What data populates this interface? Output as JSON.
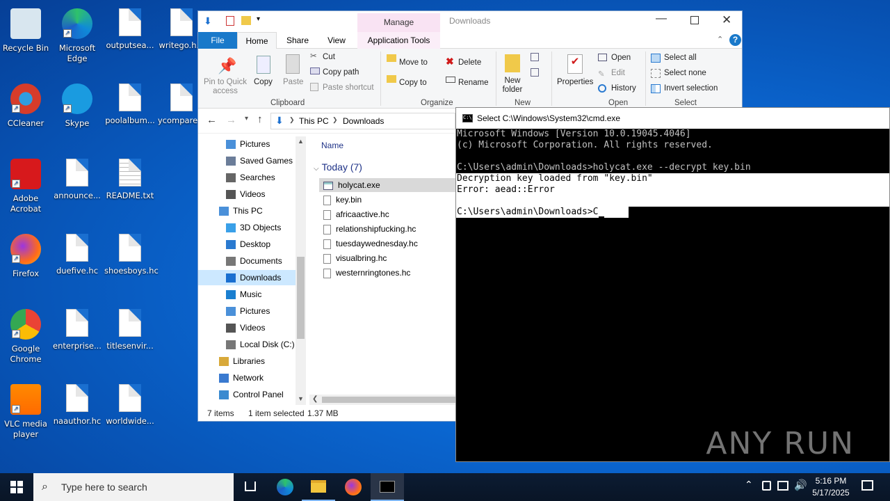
{
  "desktop": {
    "icons": [
      {
        "label": "Recycle Bin"
      },
      {
        "label": "Microsoft Edge"
      },
      {
        "label": "outputsea..."
      },
      {
        "label": "writego.h..."
      },
      {
        "label": "CCleaner"
      },
      {
        "label": "Skype"
      },
      {
        "label": "poolalbum..."
      },
      {
        "label": "ycompare..."
      },
      {
        "label": "Adobe Acrobat"
      },
      {
        "label": "announce..."
      },
      {
        "label": "README.txt"
      },
      {
        "label": "Firefox"
      },
      {
        "label": "duefive.hc"
      },
      {
        "label": "shoesboys.hc"
      },
      {
        "label": "Google Chrome"
      },
      {
        "label": "enterprise..."
      },
      {
        "label": "titlesenvir..."
      },
      {
        "label": "VLC media player"
      },
      {
        "label": "naauthor.hc"
      },
      {
        "label": "worldwide..."
      }
    ]
  },
  "explorer": {
    "title": "Downloads",
    "tabs": {
      "file": "File",
      "home": "Home",
      "share": "Share",
      "view": "View",
      "manage": "Manage",
      "app_tools": "Application Tools"
    },
    "ribbon": {
      "pin": "Pin to Quick access",
      "copy": "Copy",
      "paste": "Paste",
      "cut": "Cut",
      "copy_path": "Copy path",
      "paste_shortcut": "Paste shortcut",
      "clipboard": "Clipboard",
      "move_to": "Move to",
      "copy_to": "Copy to",
      "delete": "Delete",
      "rename": "Rename",
      "organize": "Organize",
      "new_folder": "New folder",
      "new": "New",
      "properties": "Properties",
      "open": "Open",
      "edit": "Edit",
      "history": "History",
      "open_group": "Open",
      "select_all": "Select all",
      "select_none": "Select none",
      "invert": "Invert selection",
      "select_group": "Select"
    },
    "address": {
      "this_pc": "This PC",
      "downloads": "Downloads"
    },
    "nav": [
      "Pictures",
      "Saved Games",
      "Searches",
      "Videos",
      "This PC",
      "3D Objects",
      "Desktop",
      "Documents",
      "Downloads",
      "Music",
      "Pictures",
      "Videos",
      "Local Disk (C:)",
      "Libraries",
      "Network",
      "Control Panel"
    ],
    "column_name": "Name",
    "group": "Today (7)",
    "files": [
      "holycat.exe",
      "key.bin",
      "africaactive.hc",
      "relationshipfucking.hc",
      "tuesdaywednesday.hc",
      "visualbring.hc",
      "westernringtones.hc"
    ],
    "status": {
      "items": "7 items",
      "selected": "1 item selected",
      "size": "1.37 MB"
    }
  },
  "cmd": {
    "title": "Select C:\\Windows\\System32\\cmd.exe",
    "lines": [
      "Microsoft Windows [Version 10.0.19045.4046]",
      "(c) Microsoft Corporation. All rights reserved.",
      "",
      "C:\\Users\\admin\\Downloads>holycat.exe --decrypt key.bin",
      "Decryption key loaded from \"key.bin\"",
      "Error: aead::Error",
      "",
      "C:\\Users\\admin\\Downloads>C"
    ]
  },
  "watermark": "ANY RUN",
  "taskbar": {
    "search_placeholder": "Type here to search",
    "time": "5:16 PM",
    "date": "5/17/2025"
  }
}
